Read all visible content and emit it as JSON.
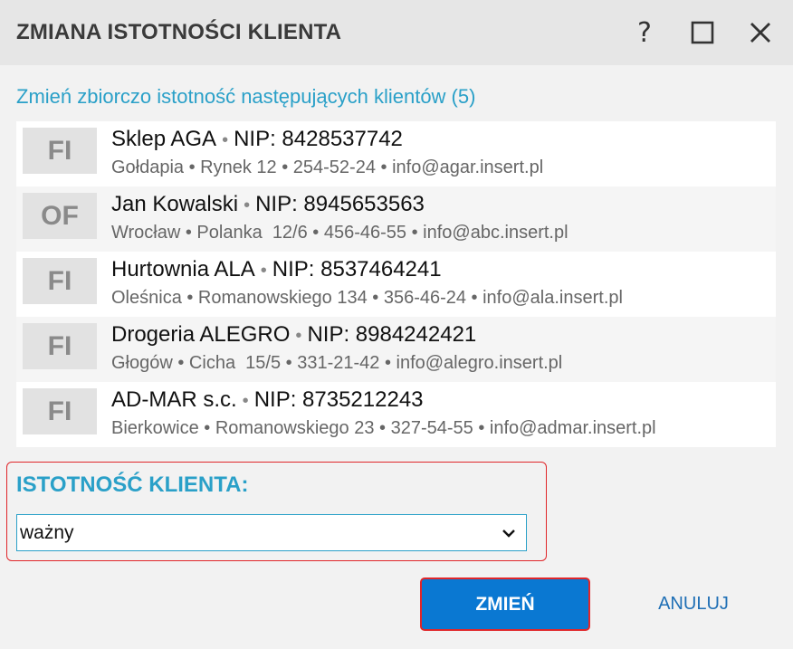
{
  "window": {
    "title": "ZMIANA ISTOTNOŚCI KLIENTA",
    "help_label": "?"
  },
  "subtitle": "Zmień zbiorczo istotność następujących klientów (5)",
  "separator": "•",
  "clients": [
    {
      "badge": "FI",
      "name": "Sklep AGA",
      "nip": "NIP: 8428537742",
      "details": "Gołdapia • Rynek 12 • 254-52-24 • info@agar.insert.pl"
    },
    {
      "badge": "OF",
      "name": "Jan Kowalski",
      "nip": "NIP: 8945653563",
      "details": "Wrocław • Polanka  12/6 • 456-46-55 • info@abc.insert.pl"
    },
    {
      "badge": "FI",
      "name": "Hurtownia ALA",
      "nip": "NIP: 8537464241",
      "details": "Oleśnica • Romanowskiego 134 • 356-46-24 • info@ala.insert.pl"
    },
    {
      "badge": "FI",
      "name": "Drogeria ALEGRO",
      "nip": "NIP: 8984242421",
      "details": "Głogów • Cicha  15/5 • 331-21-42 • info@alegro.insert.pl"
    },
    {
      "badge": "FI",
      "name": "AD-MAR s.c.",
      "nip": "NIP: 8735212243",
      "details": "Bierkowice • Romanowskiego 23 • 327-54-55 • info@admar.insert.pl"
    }
  ],
  "field": {
    "label": "ISTOTNOŚĆ KLIENTA:",
    "value": "ważny"
  },
  "buttons": {
    "confirm": "ZMIEŃ",
    "cancel": "ANULUJ"
  },
  "colors": {
    "accent": "#2aa0c8",
    "primary_button": "#0a78d2",
    "highlight_border": "#e0262a"
  }
}
